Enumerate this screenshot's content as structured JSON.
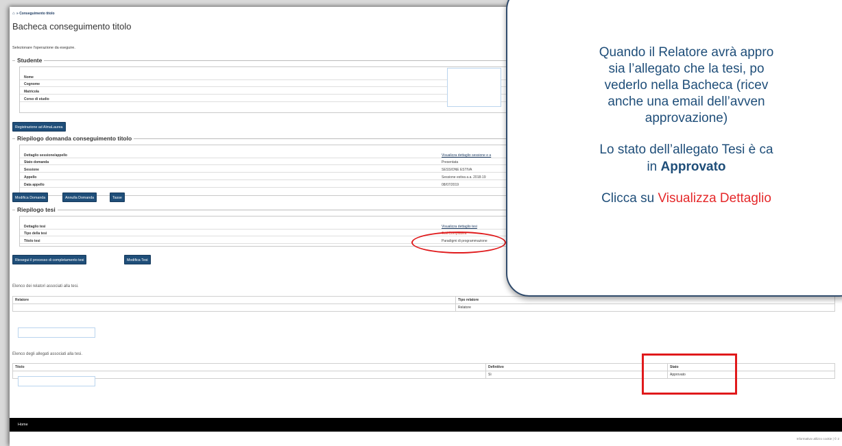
{
  "breadcrumb": {
    "home_icon": "home-icon",
    "current": "Conseguimento titolo"
  },
  "page_title": "Bacheca conseguimento titolo",
  "instruction": "Selezionare l'operazione da eseguire.",
  "student": {
    "legend": "Studente",
    "rows": [
      {
        "label": "Nome",
        "value": ""
      },
      {
        "label": "Cognome",
        "value": ""
      },
      {
        "label": "Matricola",
        "value": ""
      },
      {
        "label": "Corso di studio",
        "value": "E"
      }
    ]
  },
  "almalaurea_button": "Registrazione ad AlmaLaurea",
  "domanda": {
    "legend": "Riepilogo domanda conseguimento titolo",
    "rows": [
      {
        "label": "Dettaglio sessione/appello",
        "value": "Visualizza dettaglio sessione e a"
      },
      {
        "label": "Stato domanda",
        "value": "Presentata"
      },
      {
        "label": "Sessione",
        "value": "SESSIONE ESTIVA"
      },
      {
        "label": "Appello",
        "value": "Sessione estiva a.a. 2018-19"
      },
      {
        "label": "Data appello",
        "value": "08/07/2019"
      }
    ],
    "buttons": {
      "modifica": "Modifica Domanda",
      "annulla": "Annulla Domanda",
      "tasse": "Tasse"
    }
  },
  "tesi": {
    "legend": "Riepilogo tesi",
    "rows": [
      {
        "label": "Dettaglio tesi",
        "value": "Visualizza dettaglio tesi"
      },
      {
        "label": "Tipo della tesi",
        "value": "Tesi Compilativa"
      },
      {
        "label": "Titolo tesi",
        "value": "Paradigmi di programmazione"
      }
    ],
    "buttons": {
      "riesegui": "Riesegui il processo di completamento tesi",
      "modifica": "Modifica Tesi"
    }
  },
  "relatori": {
    "caption": "Elenco dei relatori associati alla tesi.",
    "headers": [
      "Relatore",
      "Tipo relatore"
    ],
    "rows": [
      [
        "",
        "Relatore"
      ]
    ]
  },
  "allegati": {
    "caption": "Elenco degli allegati associati alla tesi.",
    "headers": [
      "Titolo",
      "Definitivo",
      "Stato"
    ],
    "rows": [
      [
        "",
        "Sì",
        "Approvato"
      ]
    ]
  },
  "footer": {
    "home": "Home",
    "cookie": "Informativa utilizzo cookie | © 2"
  },
  "callout": {
    "lines": [
      "Quando il Relatore avrà appro",
      "sia l’allegato che la tesi, po",
      "vederlo nella Bacheca (ricev",
      "anche una email dell’avven",
      "approvazione)"
    ],
    "status_line": "Lo stato dell’allegato Tesi è ca",
    "status_prefix": "in ",
    "status_value": "Approvato",
    "click_prefix": "Clicca su ",
    "click_link": "Visualizza Dettaglio"
  },
  "colors": {
    "accent": "#1f4e79",
    "highlight": "#e0191b",
    "callout_text": "#1f4e79"
  }
}
